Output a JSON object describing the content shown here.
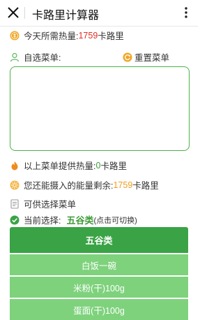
{
  "header": {
    "title": "卡路里计算器"
  },
  "daily_need": {
    "label": "今天所需热量:",
    "value": "1759",
    "unit": "卡路里"
  },
  "custom_menu": {
    "label": "自选菜单:",
    "reset_label": "重置菜单",
    "textarea_value": ""
  },
  "provided": {
    "label": "以上菜单提供热量:",
    "value": "0",
    "unit": "卡路里"
  },
  "remaining": {
    "label": "您还能摄入的能量剩余:",
    "value": "1759",
    "unit": "卡路里"
  },
  "available_menu": {
    "label": "可供选择菜单"
  },
  "current_selection": {
    "label": "当前选择:",
    "value": "五谷类",
    "hint": "(点击可切换)"
  },
  "food_list": {
    "category": "五谷类",
    "items": [
      "白饭一碗",
      "米粉(干)100g",
      "蛋面(干)100g"
    ]
  },
  "colors": {
    "accent": "#3aa345",
    "item_bg": "#7ed27c",
    "highlight_red": "#e02e24",
    "highlight_orange": "#f29c1f"
  }
}
